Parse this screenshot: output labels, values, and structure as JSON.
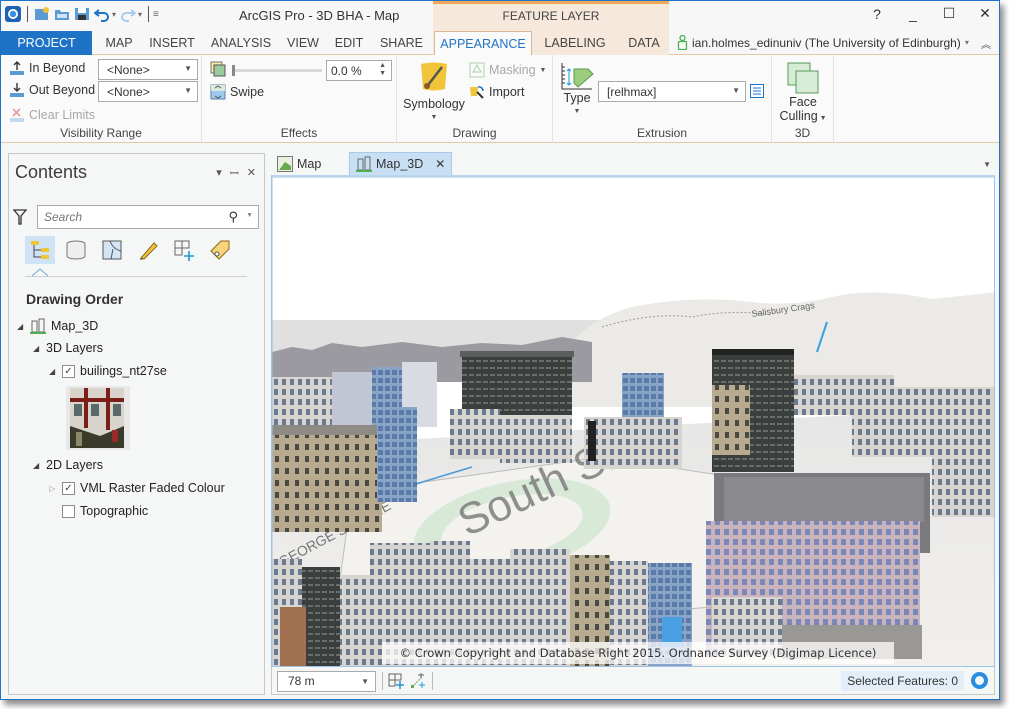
{
  "app": {
    "title": "ArcGIS Pro - 3D BHA - Map",
    "context_header": "FEATURE LAYER",
    "window_controls": {
      "help": "?",
      "minimize": "_",
      "maximize": "☐",
      "close": "✕"
    }
  },
  "quick_access": [
    {
      "icon": "arcgis-logo-icon"
    },
    {
      "icon": "new-project-icon"
    },
    {
      "icon": "open-project-icon"
    },
    {
      "icon": "save-project-icon"
    },
    {
      "icon": "undo-icon"
    },
    {
      "icon": "redo-icon"
    },
    {
      "icon": "customize-qat-icon"
    }
  ],
  "tabs": [
    {
      "label": "PROJECT"
    },
    {
      "label": "MAP"
    },
    {
      "label": "INSERT"
    },
    {
      "label": "ANALYSIS"
    },
    {
      "label": "VIEW"
    },
    {
      "label": "EDIT"
    },
    {
      "label": "SHARE"
    },
    {
      "label": "APPEARANCE",
      "active": true
    },
    {
      "label": "LABELING"
    },
    {
      "label": "DATA"
    }
  ],
  "user": {
    "name": "ian.holmes_edinuniv (The University of Edinburgh)",
    "caret": "▾",
    "collapse": "︽"
  },
  "ribbon": {
    "visibility_range": {
      "label": "Visibility Range",
      "in_beyond": "In Beyond",
      "out_beyond": "Out Beyond",
      "clear_limits": "Clear Limits",
      "in_beyond_value": "<None>",
      "out_beyond_value": "<None>"
    },
    "effects": {
      "label": "Effects",
      "transparency_value": "0.0 %",
      "transparency_percent": 0,
      "swipe": "Swipe"
    },
    "drawing": {
      "label": "Drawing",
      "symbology": "Symbology",
      "masking": "Masking",
      "import": "Import"
    },
    "extrusion": {
      "label": "Extrusion",
      "type": "Type",
      "expression_value": "[relhmax]"
    },
    "three_d": {
      "label": "3D",
      "face_culling_line1": "Face",
      "face_culling_line2": "Culling"
    }
  },
  "contents": {
    "title": "Contents",
    "search_placeholder": "Search",
    "section_title": "Drawing Order",
    "tree": {
      "map": "Map_3D",
      "layers_3d": "3D Layers",
      "buildings": "builings_nt27se",
      "layers_2d": "2D Layers",
      "vml": "VML Raster Faded Colour",
      "topographic": "Topographic"
    },
    "checked": {
      "buildings": true,
      "vml": true,
      "topographic": false
    }
  },
  "view_tabs": [
    {
      "label": "Map"
    },
    {
      "label": "Map_3D",
      "active": true,
      "close": "✕"
    }
  ],
  "scene": {
    "copyright": "© Crown Copyright and Database Right 2015. Ordnance Survey (Digimap Licence)",
    "map_labels": [
      "Salisbury Crags",
      "South Side",
      "GEORGE SQUARE"
    ]
  },
  "statusbar": {
    "scale": "78 m",
    "selected_features": "Selected Features: 0"
  },
  "colors": {
    "accent": "#1e73c6",
    "context_tab": "#f6e9dc",
    "context_accent": "#f0a858"
  }
}
